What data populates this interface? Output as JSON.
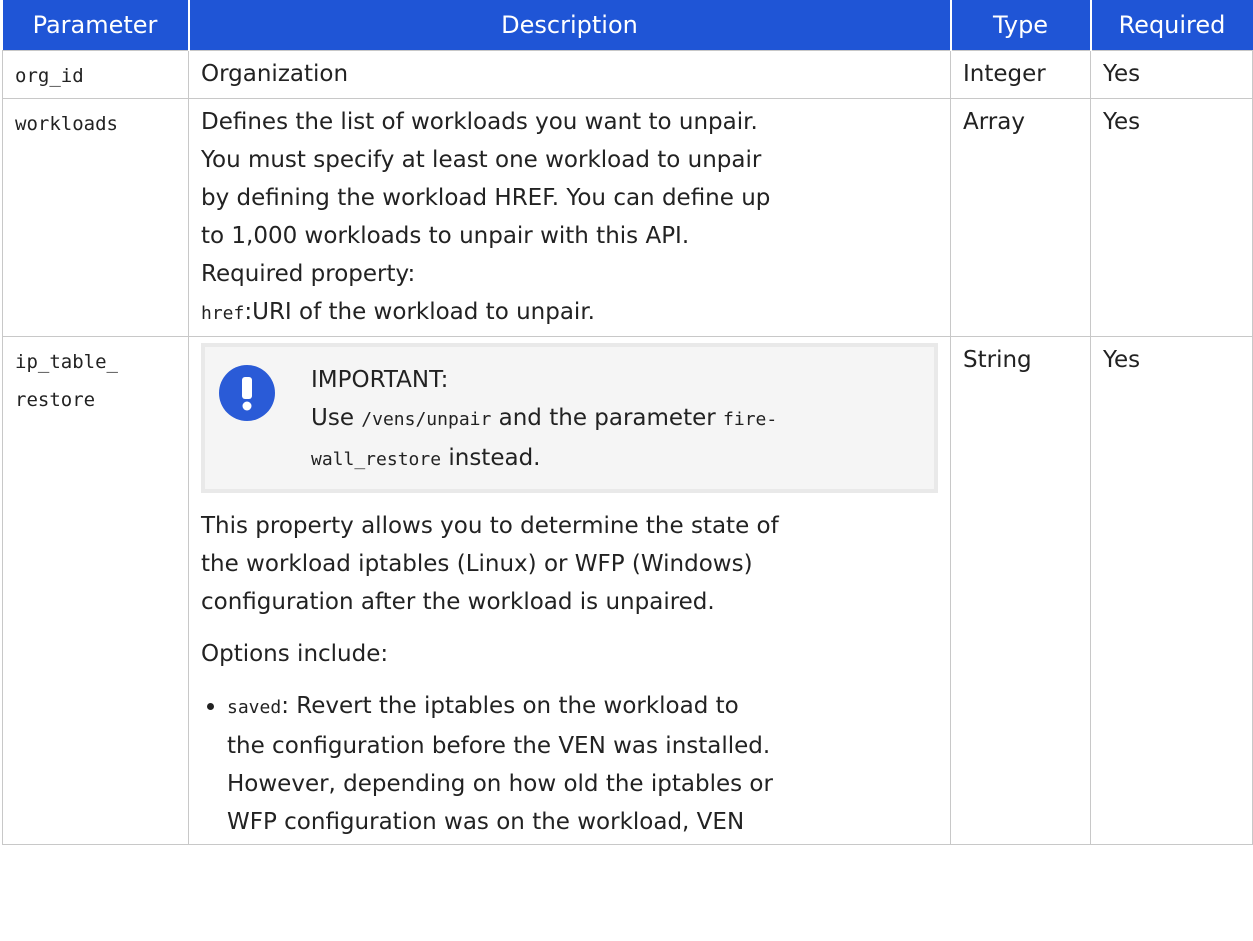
{
  "table": {
    "headers": {
      "parameter": "Parameter",
      "description": "Description",
      "type": "Type",
      "required": "Required"
    },
    "rows": [
      {
        "param": "org_id",
        "description": "Organization",
        "type": "Integer",
        "required": "Yes"
      },
      {
        "param": "workloads",
        "description_lines": [
          "Defines the list of workloads you want to unpair.",
          "You must specify at least one workload to unpair",
          "by defining the workload HREF. You can define up",
          "to 1,000 workloads to unpair with this API.",
          "Required property:"
        ],
        "href_code": "href",
        "href_text": ":URI of the workload to unpair.",
        "type": "Array",
        "required": "Yes"
      },
      {
        "param_line1": "ip_table_",
        "param_line2": "restore",
        "important": {
          "title": "IMPORTANT:",
          "text1": "Use ",
          "code1": "/vens/unpair",
          "text2": " and the parameter ",
          "code2a": "fire-",
          "code2b": "wall_restore",
          "text3": " instead."
        },
        "para1_lines": [
          "This property allows you to determine the state of",
          "the workload iptables (Linux) or WFP (Windows)",
          "configuration after the workload is unpaired."
        ],
        "para2": "Options include:",
        "option_code": "saved",
        "option_lines": [
          ": Revert the iptables on the workload to",
          "the configuration before the VEN was installed.",
          "However, depending on how old the iptables or",
          "WFP configuration was on the workload, VEN"
        ],
        "type": "String",
        "required": "Yes"
      }
    ]
  },
  "icons": {
    "important": "exclamation-icon"
  },
  "colors": {
    "header_bg": "#1f55d6",
    "icon_bg": "#2a5bd7",
    "note_bg": "#f5f5f5"
  }
}
